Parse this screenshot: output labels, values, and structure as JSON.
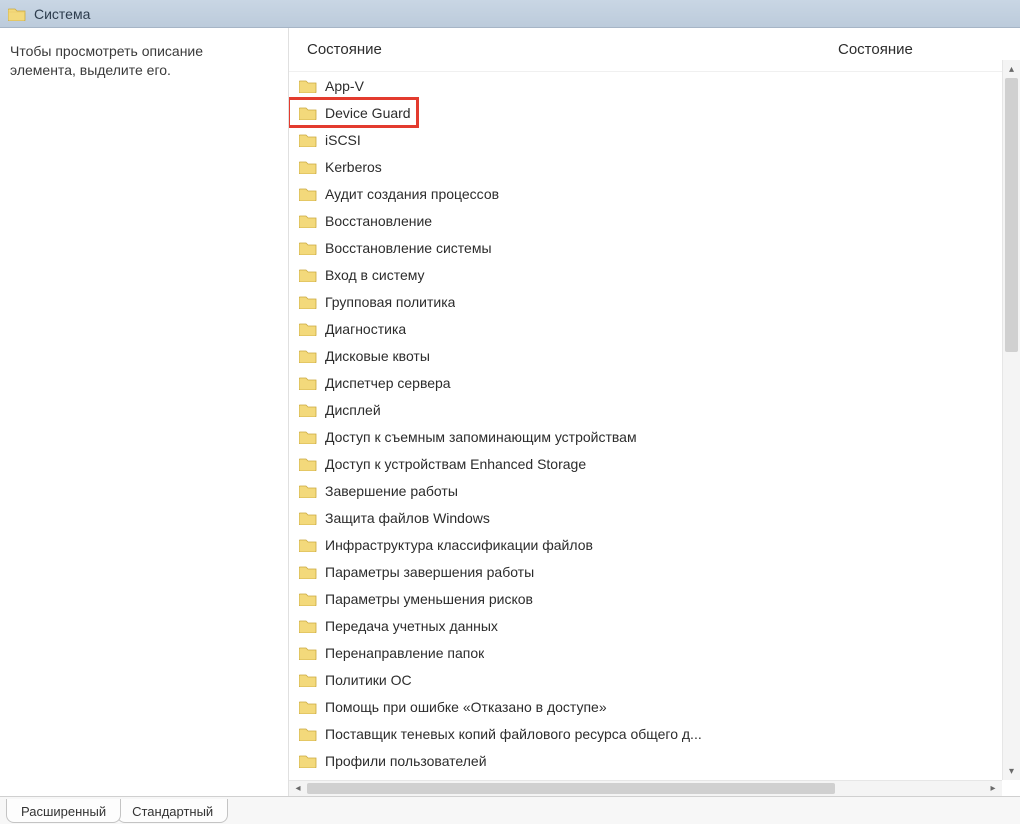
{
  "titlebar": {
    "title": "Система"
  },
  "description_pane": {
    "text": "Чтобы просмотреть описание элемента, выделите его."
  },
  "columns": {
    "main": "Состояние",
    "right": "Состояние"
  },
  "folders": [
    {
      "label": "App-V",
      "highlighted": false
    },
    {
      "label": "Device Guard",
      "highlighted": true
    },
    {
      "label": "iSCSI",
      "highlighted": false
    },
    {
      "label": "Kerberos",
      "highlighted": false
    },
    {
      "label": "Аудит создания процессов",
      "highlighted": false
    },
    {
      "label": "Восстановление",
      "highlighted": false
    },
    {
      "label": "Восстановление системы",
      "highlighted": false
    },
    {
      "label": "Вход в систему",
      "highlighted": false
    },
    {
      "label": "Групповая политика",
      "highlighted": false
    },
    {
      "label": "Диагностика",
      "highlighted": false
    },
    {
      "label": "Дисковые квоты",
      "highlighted": false
    },
    {
      "label": "Диспетчер сервера",
      "highlighted": false
    },
    {
      "label": "Дисплей",
      "highlighted": false
    },
    {
      "label": "Доступ к съемным запоминающим устройствам",
      "highlighted": false
    },
    {
      "label": "Доступ к устройствам Enhanced Storage",
      "highlighted": false
    },
    {
      "label": "Завершение работы",
      "highlighted": false
    },
    {
      "label": "Защита файлов Windows",
      "highlighted": false
    },
    {
      "label": "Инфраструктура классификации файлов",
      "highlighted": false
    },
    {
      "label": "Параметры завершения работы",
      "highlighted": false
    },
    {
      "label": "Параметры уменьшения рисков",
      "highlighted": false
    },
    {
      "label": "Передача учетных данных",
      "highlighted": false
    },
    {
      "label": "Перенаправление папок",
      "highlighted": false
    },
    {
      "label": "Политики ОС",
      "highlighted": false
    },
    {
      "label": "Помощь при ошибке «Отказано в доступе»",
      "highlighted": false
    },
    {
      "label": "Поставщик теневых копий файлового ресурса общего д...",
      "highlighted": false
    },
    {
      "label": "Профили пользователей",
      "highlighted": false
    }
  ],
  "tabs": {
    "extended": "Расширенный",
    "standard": "Стандартный"
  }
}
